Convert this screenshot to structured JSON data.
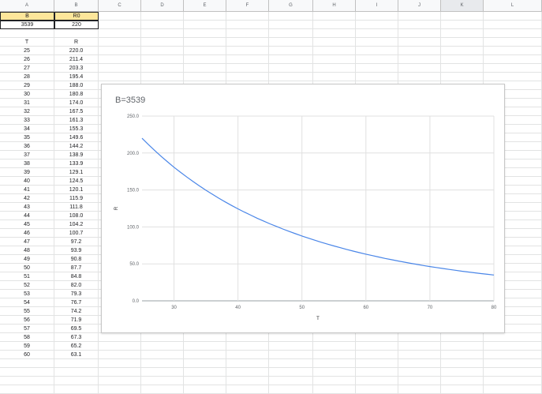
{
  "sheet": {
    "columns": [
      "A",
      "B",
      "C",
      "D",
      "E",
      "F",
      "G",
      "H",
      "I",
      "J",
      "K",
      "L"
    ],
    "selected_column": "K",
    "params_header": [
      "B",
      "R0"
    ],
    "params_values": [
      "3539",
      "220"
    ],
    "table_header": [
      "T",
      "R"
    ],
    "rows": [
      [
        "25",
        "220.0"
      ],
      [
        "26",
        "211.4"
      ],
      [
        "27",
        "203.3"
      ],
      [
        "28",
        "195.4"
      ],
      [
        "29",
        "188.0"
      ],
      [
        "30",
        "180.8"
      ],
      [
        "31",
        "174.0"
      ],
      [
        "32",
        "167.5"
      ],
      [
        "33",
        "161.3"
      ],
      [
        "34",
        "155.3"
      ],
      [
        "35",
        "149.6"
      ],
      [
        "36",
        "144.2"
      ],
      [
        "37",
        "138.9"
      ],
      [
        "38",
        "133.9"
      ],
      [
        "39",
        "129.1"
      ],
      [
        "40",
        "124.5"
      ],
      [
        "41",
        "120.1"
      ],
      [
        "42",
        "115.9"
      ],
      [
        "43",
        "111.8"
      ],
      [
        "44",
        "108.0"
      ],
      [
        "45",
        "104.2"
      ],
      [
        "46",
        "100.7"
      ],
      [
        "47",
        "97.2"
      ],
      [
        "48",
        "93.9"
      ],
      [
        "49",
        "90.8"
      ],
      [
        "50",
        "87.7"
      ],
      [
        "51",
        "84.8"
      ],
      [
        "52",
        "82.0"
      ],
      [
        "53",
        "79.3"
      ],
      [
        "54",
        "76.7"
      ],
      [
        "55",
        "74.2"
      ],
      [
        "56",
        "71.9"
      ],
      [
        "57",
        "69.5"
      ],
      [
        "58",
        "67.3"
      ],
      [
        "59",
        "65.2"
      ],
      [
        "60",
        "63.1"
      ]
    ]
  },
  "chart": {
    "title": "B=3539",
    "xlabel": "T",
    "ylabel": "R",
    "line_color": "#4a86e8"
  },
  "chart_data": {
    "type": "line",
    "title": "B=3539",
    "xlabel": "T",
    "ylabel": "R",
    "xlim": [
      25,
      80
    ],
    "ylim": [
      0,
      250
    ],
    "xticks": [
      "30",
      "40",
      "50",
      "60",
      "70",
      "80"
    ],
    "yticks": [
      "0.0",
      "50.0",
      "100.0",
      "150.0",
      "200.0",
      "250.0"
    ],
    "grid": true,
    "series": [
      {
        "x": [
          25,
          26,
          27,
          28,
          29,
          30,
          31,
          32,
          33,
          34,
          35,
          36,
          37,
          38,
          39,
          40,
          41,
          42,
          43,
          44,
          45,
          46,
          47,
          48,
          49,
          50,
          51,
          52,
          53,
          54,
          55,
          56,
          57,
          58,
          59,
          60,
          61,
          62,
          63,
          64,
          65,
          66,
          67,
          68,
          69,
          70,
          71,
          72,
          73,
          74,
          75,
          76,
          77,
          78,
          79,
          80
        ],
        "values": [
          220.0,
          211.4,
          203.3,
          195.4,
          188.0,
          180.8,
          174.0,
          167.5,
          161.3,
          155.3,
          149.6,
          144.2,
          138.9,
          133.9,
          129.1,
          124.5,
          120.1,
          115.9,
          111.8,
          108.0,
          104.2,
          100.7,
          97.2,
          93.9,
          90.8,
          87.7,
          84.8,
          82.0,
          79.3,
          76.7,
          74.2,
          71.9,
          69.5,
          67.3,
          65.2,
          63.1,
          61.2,
          59.3,
          57.4,
          55.7,
          54.0,
          52.4,
          50.8,
          49.3,
          47.8,
          46.4,
          45.1,
          43.8,
          42.5,
          41.3,
          40.1,
          39.0,
          37.9,
          36.9,
          35.9,
          34.9
        ]
      }
    ]
  }
}
